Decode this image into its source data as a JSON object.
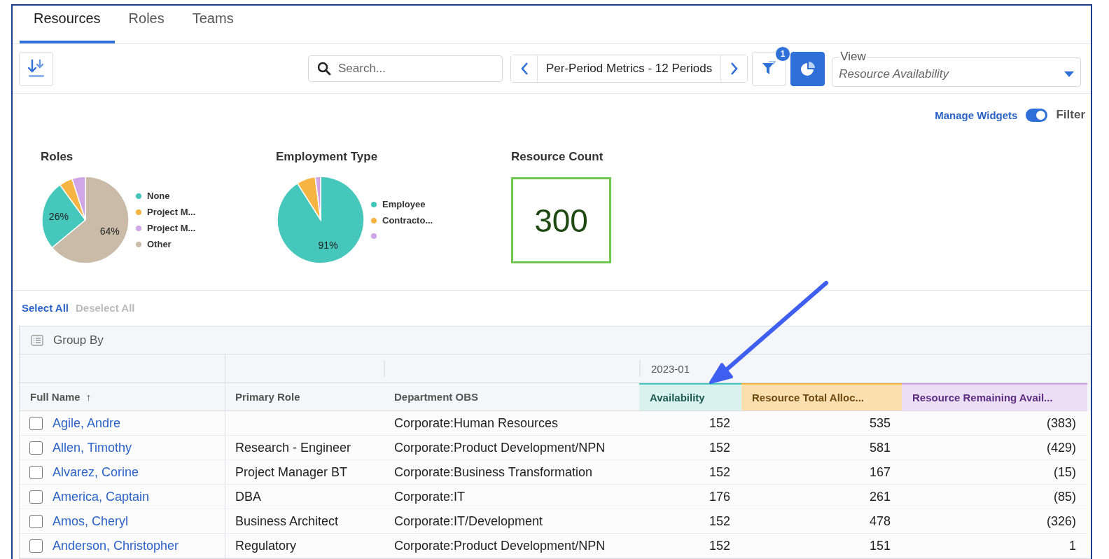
{
  "tabs": [
    {
      "label": "Resources",
      "selected": true
    },
    {
      "label": "Roles",
      "selected": false
    },
    {
      "label": "Teams",
      "selected": false
    }
  ],
  "toolbar": {
    "search": {
      "placeholder": "Search..."
    },
    "period": "Per-Period Metrics - 12 Periods",
    "filter_badge": "1",
    "widgets_on": true,
    "view": {
      "label": "View",
      "value": "Resource Availability"
    }
  },
  "widgets_bar": {
    "link": "Manage Widgets",
    "filter_toggle": {
      "label": "Filter",
      "on": true
    }
  },
  "widgets": [
    {
      "title": "Roles",
      "kind": "pie",
      "chart_data": {
        "type": "pie",
        "categories": [
          "None",
          "Project M...",
          "Project M...",
          "Other"
        ],
        "values": [
          26,
          5,
          5,
          64
        ],
        "colors": [
          "#45c8bb",
          "#f6b443",
          "#cfa6e8",
          "#c9bba8"
        ],
        "value_labels": [
          "26%",
          null,
          null,
          "64%"
        ]
      }
    },
    {
      "title": "Employment Type",
      "kind": "pie",
      "chart_data": {
        "type": "pie",
        "categories": [
          "Employee",
          "Contracto...",
          null
        ],
        "values": [
          91,
          7,
          2
        ],
        "colors": [
          "#45c8bb",
          "#f6b443",
          "#cfa6e8"
        ],
        "value_labels": [
          "91%",
          null,
          null
        ]
      }
    },
    {
      "title": "Resource Count",
      "kind": "count",
      "value": "300"
    }
  ],
  "selection": {
    "select_all": "Select All",
    "deselect_all": "Deselect All"
  },
  "table": {
    "group_by": "Group By",
    "period": "2023-01",
    "columns": [
      {
        "label": "Full Name",
        "sort": "↑",
        "kind": "plain"
      },
      {
        "label": "Primary Role",
        "kind": "plain"
      },
      {
        "label": "Department OBS",
        "kind": "plain"
      },
      {
        "label": "Availability",
        "kind": "availability"
      },
      {
        "label": "Resource Total Alloc...",
        "kind": "allocation"
      },
      {
        "label": "Resource Remaining Avail...",
        "kind": "remaining"
      }
    ],
    "rows": [
      {
        "checked": false,
        "name": "Agile, Andre",
        "role": "",
        "department": "Corporate:Human Resources",
        "availability": "152",
        "allocation": "535",
        "remaining": "(383)"
      },
      {
        "checked": false,
        "name": "Allen, Timothy",
        "role": "Research - Engineer",
        "department": "Corporate:Product Development/NPN",
        "availability": "152",
        "allocation": "581",
        "remaining": "(429)"
      },
      {
        "checked": false,
        "name": "Alvarez, Corine",
        "role": "Project Manager BT",
        "department": "Corporate:Business Transformation",
        "availability": "152",
        "allocation": "167",
        "remaining": "(15)"
      },
      {
        "checked": false,
        "name": "America, Captain",
        "role": "DBA",
        "department": "Corporate:IT",
        "availability": "176",
        "allocation": "261",
        "remaining": "(85)"
      },
      {
        "checked": false,
        "name": "Amos, Cheryl",
        "role": "Business Architect",
        "department": "Corporate:IT/Development",
        "availability": "152",
        "allocation": "478",
        "remaining": "(326)"
      },
      {
        "checked": false,
        "name": "Anderson, Christopher",
        "role": "Regulatory",
        "department": "Corporate:Product Development/NPN",
        "availability": "152",
        "allocation": "151",
        "remaining": "1"
      }
    ]
  }
}
